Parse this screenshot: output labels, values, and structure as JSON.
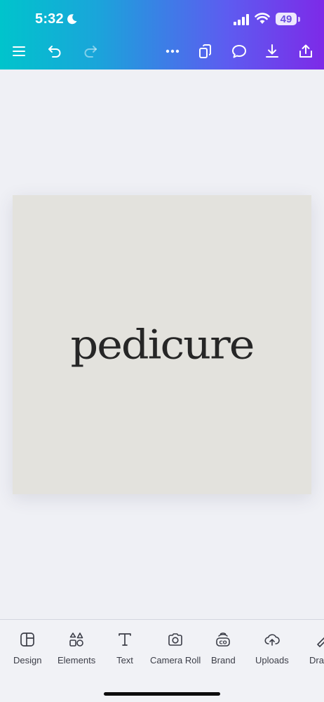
{
  "status_bar": {
    "time": "5:32",
    "battery": "49"
  },
  "toolbar": {
    "icons": [
      "menu-icon",
      "undo-icon",
      "redo-icon",
      "more-icon",
      "pages-icon",
      "comment-icon",
      "download-icon",
      "share-icon"
    ]
  },
  "canvas": {
    "text": "pedicure",
    "background_color": "#e3e2dd",
    "text_color": "#262626"
  },
  "bottom_nav": {
    "items": [
      {
        "label": "Design",
        "icon": "design-icon"
      },
      {
        "label": "Elements",
        "icon": "elements-icon"
      },
      {
        "label": "Text",
        "icon": "text-icon"
      },
      {
        "label": "Camera Roll",
        "icon": "camera-icon"
      },
      {
        "label": "Brand",
        "icon": "brand-icon"
      },
      {
        "label": "Uploads",
        "icon": "uploads-icon"
      },
      {
        "label": "Dra",
        "icon": "draw-icon"
      }
    ]
  },
  "colors": {
    "gradient_start": "#00c4cc",
    "gradient_end": "#7d2ae8"
  }
}
